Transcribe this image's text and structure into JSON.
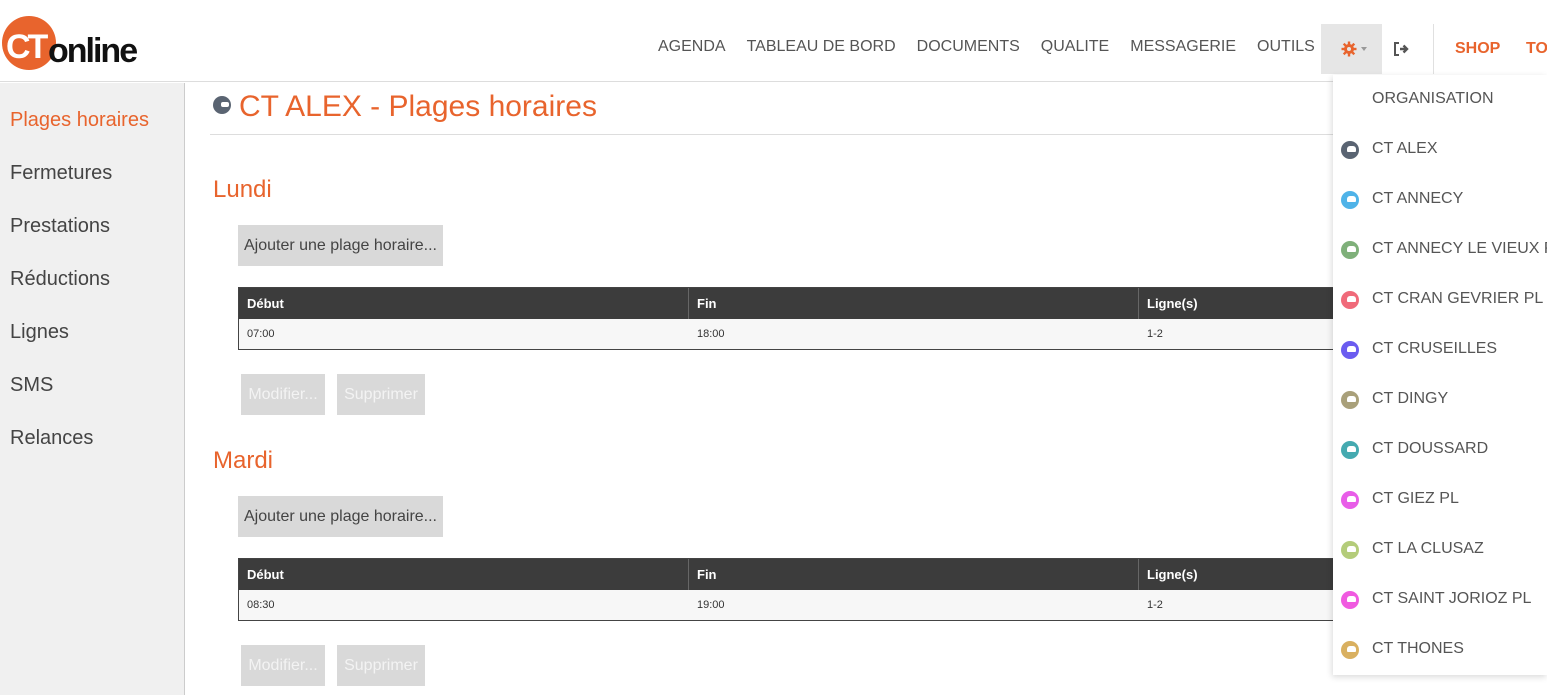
{
  "header": {
    "logo_ct": "CT",
    "logo_online": "online",
    "nav": [
      "AGENDA",
      "TABLEAU DE BORD",
      "DOCUMENTS",
      "QUALITE",
      "MESSAGERIE",
      "OUTILS"
    ],
    "shop": "SHOP",
    "to": "TO"
  },
  "sidebar": {
    "items": [
      "Plages horaires",
      "Fermetures",
      "Prestations",
      "Réductions",
      "Lignes",
      "SMS",
      "Relances"
    ]
  },
  "main": {
    "title": "CT ALEX - Plages horaires",
    "add_label": "Ajouter une plage horaire...",
    "modify_label": "Modifier...",
    "delete_label": "Supprimer",
    "columns": [
      "Début",
      "Fin",
      "Ligne(s)"
    ],
    "days": [
      {
        "name": "Lundi",
        "row": [
          "07:00",
          "18:00",
          "1-2"
        ]
      },
      {
        "name": "Mardi",
        "row": [
          "08:30",
          "19:00",
          "1-2"
        ]
      }
    ]
  },
  "dropdown": {
    "header": "ORGANISATION",
    "items": [
      {
        "label": "CT ALEX",
        "color": "#5a6472"
      },
      {
        "label": "CT ANNECY",
        "color": "#4fb3e8"
      },
      {
        "label": "CT ANNECY LE VIEUX P",
        "color": "#7fb07a"
      },
      {
        "label": "CT CRAN GEVRIER PL",
        "color": "#f06a7a"
      },
      {
        "label": "CT CRUSEILLES",
        "color": "#6b5cf0"
      },
      {
        "label": "CT DINGY",
        "color": "#a9a07a"
      },
      {
        "label": "CT DOUSSARD",
        "color": "#45aab0"
      },
      {
        "label": "CT GIEZ PL",
        "color": "#e85de8"
      },
      {
        "label": "CT LA CLUSAZ",
        "color": "#b4cc7a"
      },
      {
        "label": "CT SAINT JORIOZ PL",
        "color": "#f05ae0"
      },
      {
        "label": "CT THONES",
        "color": "#d9b060"
      }
    ]
  }
}
